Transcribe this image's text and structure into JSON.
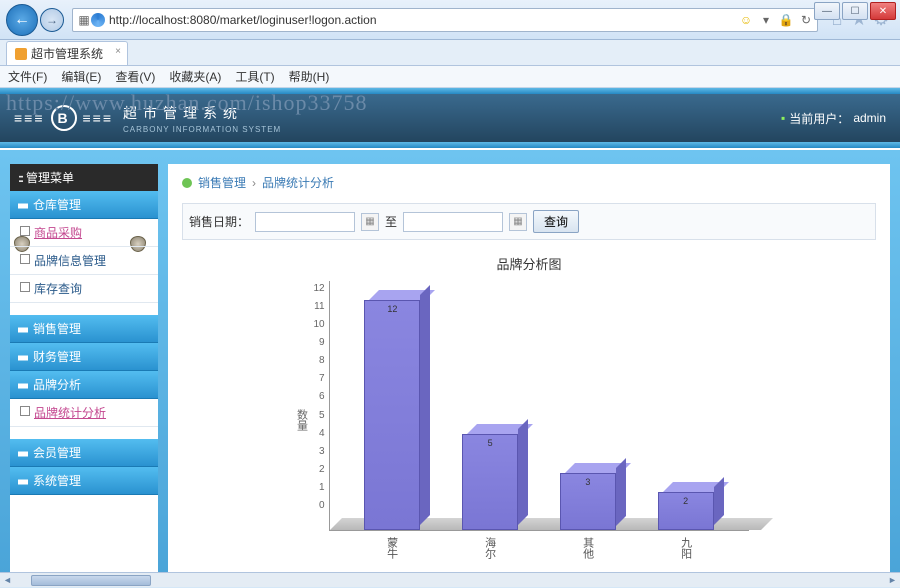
{
  "browser": {
    "url": "http://localhost:8080/market/loginuser!logon.action",
    "tab_title": "超市管理系统"
  },
  "menubar": {
    "file": "文件(F)",
    "edit": "编辑(E)",
    "view": "查看(V)",
    "favorites": "收藏夹(A)",
    "tools": "工具(T)",
    "help": "帮助(H)"
  },
  "watermark": "https://www.huzhan.com/ishop33758",
  "app": {
    "title": "超市管理系统",
    "subtitle": "CARBONY INFORMATION SYSTEM",
    "user_label": "当前用户：",
    "user_name": "admin"
  },
  "sidebar": {
    "menu_title": "管理菜单",
    "groups": [
      {
        "head": "仓库管理",
        "items": [
          "商品采购",
          "品牌信息管理",
          "库存查询"
        ]
      },
      {
        "head": "销售管理",
        "items": []
      },
      {
        "head": "财务管理",
        "items": []
      },
      {
        "head": "品牌分析",
        "items": [
          "品牌统计分析"
        ]
      },
      {
        "head": "会员管理",
        "items": []
      },
      {
        "head": "系统管理",
        "items": []
      }
    ]
  },
  "breadcrumb": {
    "a": "销售管理",
    "b": "品牌统计分析"
  },
  "filter": {
    "label": "销售日期：",
    "to": "至",
    "query": "查询"
  },
  "chart_data": {
    "type": "bar",
    "title": "品牌分析图",
    "ylabel": "数量",
    "categories": [
      "蒙牛",
      "海尔",
      "其他",
      "九阳"
    ],
    "values": [
      12,
      5,
      3,
      2
    ],
    "ylim": [
      0,
      12
    ],
    "yticks": [
      12,
      11,
      10,
      9,
      8,
      7,
      6,
      5,
      4,
      3,
      2,
      1,
      0
    ]
  }
}
